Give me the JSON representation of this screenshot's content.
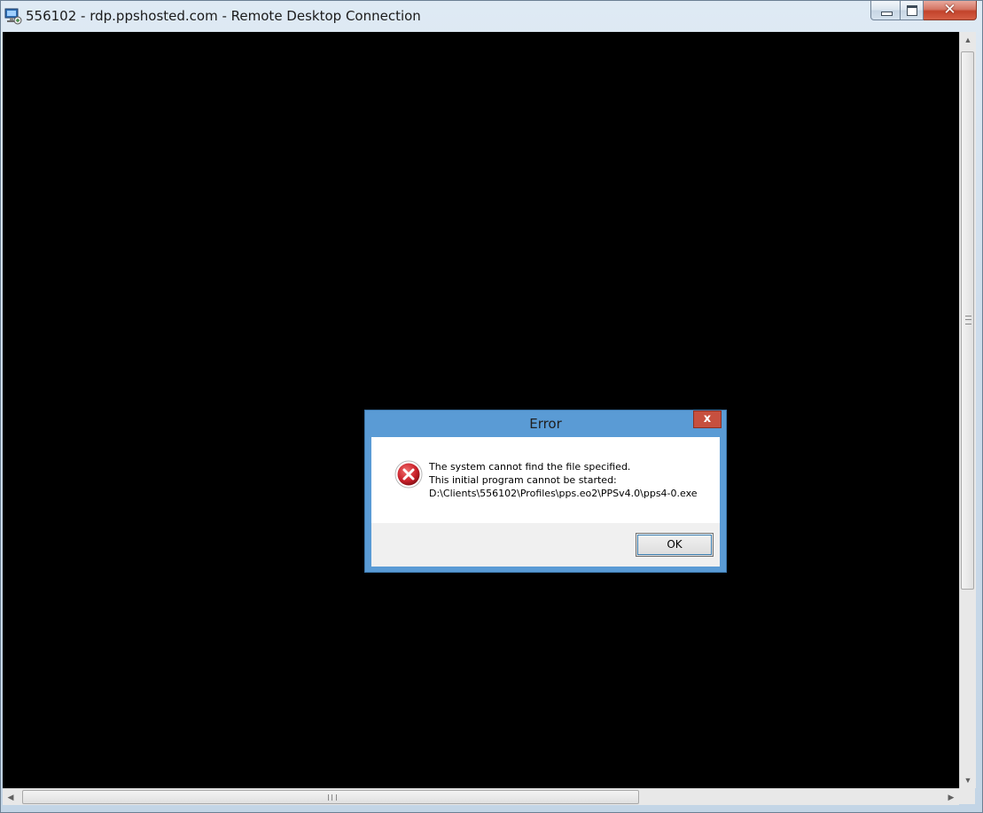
{
  "window": {
    "title": "556102 - rdp.ppshosted.com - Remote Desktop Connection",
    "icon": "remote-desktop-icon",
    "buttons": {
      "minimize": "minimize-icon",
      "maximize": "maximize-icon",
      "close": "✕"
    }
  },
  "dialog": {
    "title": "Error",
    "close_label": "x",
    "icon": "error-icon",
    "message_lines": [
      "The system cannot find the file specified.",
      "This initial program cannot be started:",
      "D:\\Clients\\556102\\Profiles\\pps.eo2\\PPSv4.0\\pps4-0.exe"
    ],
    "ok_label": "OK"
  },
  "scrollbars": {
    "up_arrow": "▲",
    "down_arrow": "▼",
    "left_arrow": "◀",
    "right_arrow": "▶"
  },
  "colors": {
    "client_background": "#000000",
    "dialog_frame": "#5a9bd5",
    "dialog_close": "#c7503f",
    "error_icon": "#c9202a"
  }
}
